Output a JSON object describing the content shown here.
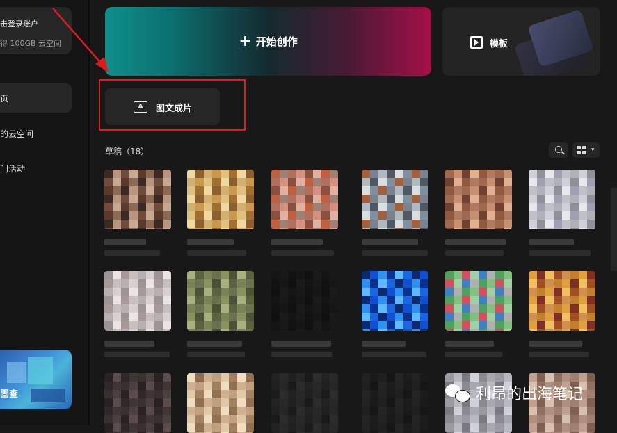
{
  "sidebar": {
    "login_title": "击登录账户",
    "login_subtitle": "得 100GB 云空间",
    "nav_home": "页",
    "nav_items": [
      "的云空间",
      "门活动"
    ],
    "promo_label": "固查"
  },
  "toolbar": {
    "create_label": "开始创作",
    "create_icon": "plus-icon",
    "template_label": "模板",
    "template_icon": "play-square-icon",
    "tuwen_label": "图文成片",
    "tuwen_icon": "image-text-icon"
  },
  "drafts": {
    "label": "草稿（18）",
    "search_icon": "search-icon",
    "view_icon": "grid-view-icon"
  },
  "watermark": {
    "text": "利昂的出海笔记",
    "icon": "wechat-icon"
  },
  "colors": {
    "highlight": "#e01b1b",
    "create_gradient_start": "#0f8f8a",
    "create_gradient_end": "#a50f48"
  }
}
